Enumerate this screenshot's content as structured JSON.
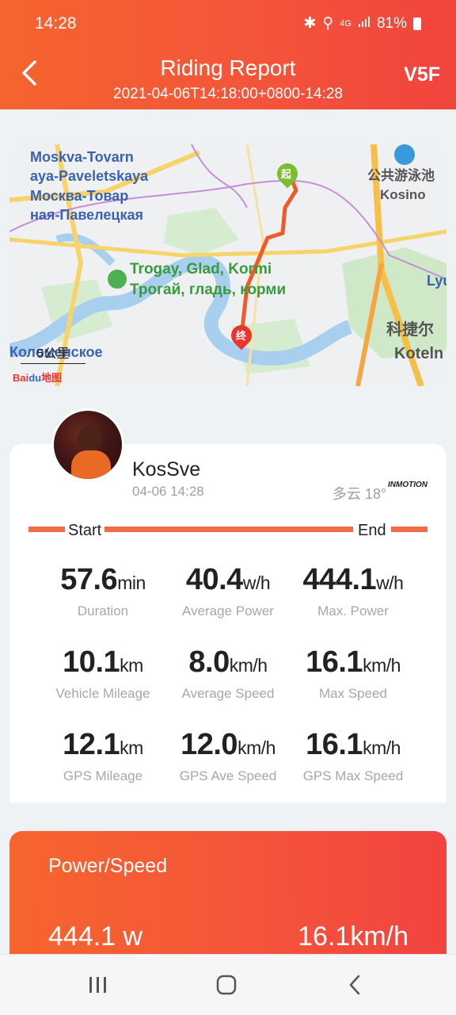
{
  "status": {
    "time": "14:28",
    "network": "4G",
    "battery": "81%"
  },
  "header": {
    "title": "Riding Report",
    "subtitle": "2021-04-06T14:18:00+0800-14:28",
    "device": "V5F",
    "back_icon": "chevron-left-icon"
  },
  "map": {
    "labels": {
      "moskva_latin": "Moskva-Tovarn\naya-Paveletskaya",
      "moskva_cyr": "Москва-Товар\nная-Павелецкая",
      "trogay_latin": "Trogay, Glad, Kormi",
      "trogay_cyr": "Трогай, гладь, корми",
      "pool": "公共游泳池",
      "kosino": "Kosino",
      "lyu": "Lyu",
      "kotel_cn": "科捷尔",
      "kotel": "Koteln",
      "kolomenskoe": "Коломенское"
    },
    "start_marker": "起",
    "end_marker": "终",
    "scale": "5公里",
    "logo_bai": "Bai",
    "logo_du": "du",
    "logo_map": "地图",
    "route_color": "#f05a28"
  },
  "profile": {
    "username": "KosSve",
    "datetime": "04-06 14:28",
    "weather": "多云 18°",
    "brand": "INMOTION"
  },
  "progress": {
    "start_label": "Start",
    "end_label": "End"
  },
  "stats": [
    {
      "value": "57.6",
      "unit": "min",
      "label": "Duration"
    },
    {
      "value": "40.4",
      "unit": "w/h",
      "label": "Average Power"
    },
    {
      "value": "444.1",
      "unit": "w/h",
      "label": "Max. Power"
    },
    {
      "value": "10.1",
      "unit": "km",
      "label": "Vehicle Mileage"
    },
    {
      "value": "8.0",
      "unit": "km/h",
      "label": "Average Speed"
    },
    {
      "value": "16.1",
      "unit": "km/h",
      "label": "Max Speed"
    },
    {
      "value": "12.1",
      "unit": "km",
      "label": "GPS Mileage"
    },
    {
      "value": "12.0",
      "unit": "km/h",
      "label": "GPS Ave Speed"
    },
    {
      "value": "16.1",
      "unit": "km/h",
      "label": "GPS Max Speed"
    }
  ],
  "power_speed": {
    "title": "Power/Speed",
    "power": "444.1 w",
    "speed": "16.1km/h"
  },
  "colors": {
    "accent": "#f4553a",
    "bar": "#f26a48"
  }
}
